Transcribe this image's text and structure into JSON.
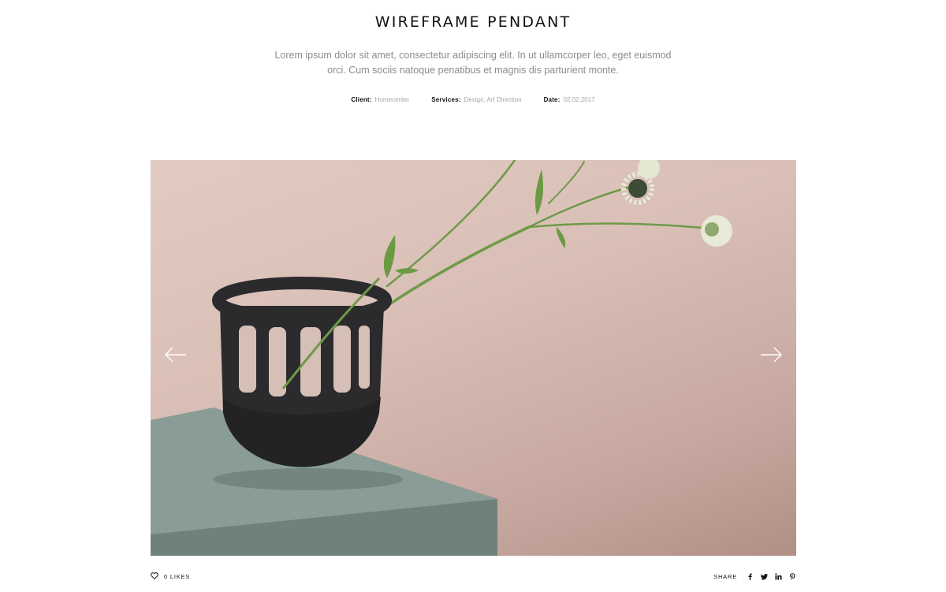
{
  "project": {
    "title": "WIREFRAME PENDANT",
    "description": "Lorem ipsum dolor sit amet, consectetur adipiscing elit. In ut ullamcorper leo, eget euismod orci. Cum sociis natoque penatibus et magnis dis parturient monte.",
    "meta": [
      {
        "label": "Client:",
        "value": "Homecenter"
      },
      {
        "label": "Services:",
        "value": "Design, Art Direction"
      },
      {
        "label": "Date:",
        "value": "02.02.2017"
      }
    ]
  },
  "slider": {
    "prev_icon": "arrow-left-icon",
    "next_icon": "arrow-right-icon",
    "image_subject": "black ceramic vessel with flower on a grey-green pedestal",
    "colors": {
      "wall": "#dcc4bb",
      "pedestal": "#7f918b",
      "vessel": "#2a2a2c",
      "stem": "#6f9a4a"
    }
  },
  "footer": {
    "likes_icon": "heart-icon",
    "likes_count": "0",
    "likes_label": "LIKES",
    "share_label": "SHARE",
    "social": [
      "facebook-icon",
      "twitter-icon",
      "linkedin-icon",
      "pinterest-icon"
    ]
  }
}
